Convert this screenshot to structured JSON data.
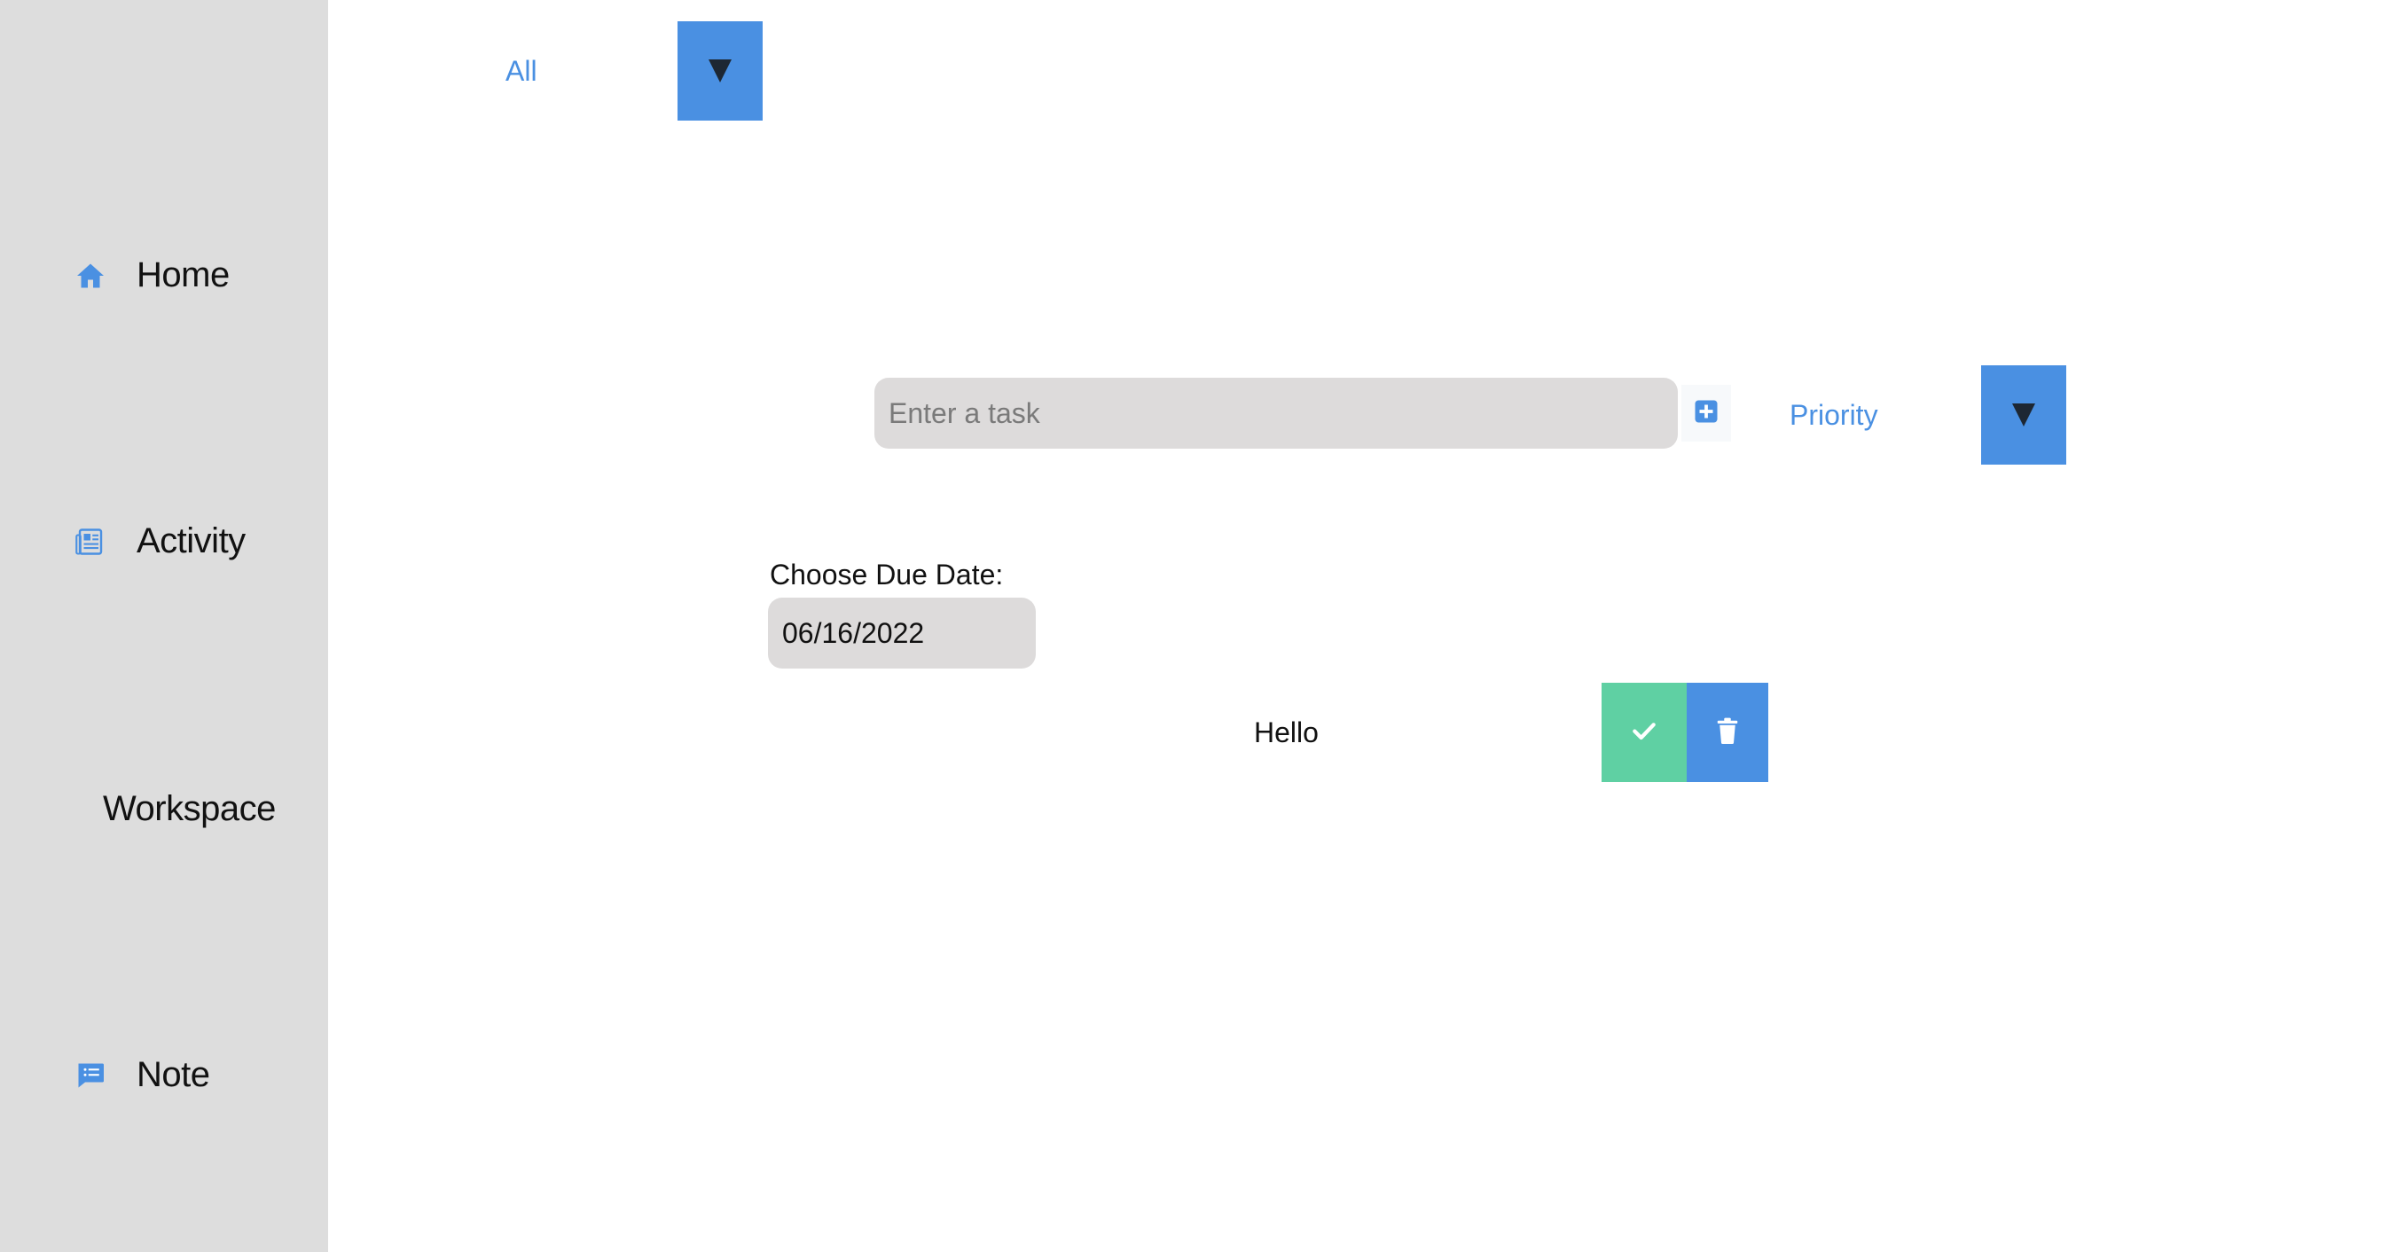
{
  "sidebar": {
    "items": [
      {
        "label": "Home",
        "icon": "home-icon"
      },
      {
        "label": "Activity",
        "icon": "newspaper-icon"
      },
      {
        "label": "Workspace",
        "icon": ""
      },
      {
        "label": "Note",
        "icon": "comment-list-icon"
      }
    ]
  },
  "filter": {
    "selected": "All"
  },
  "task_form": {
    "input_placeholder": "Enter a task",
    "input_value": "",
    "add_icon": "plus-square-icon",
    "priority_selected": "Priority"
  },
  "due_date": {
    "label": "Choose Due Date:",
    "value": "06/16/2022"
  },
  "todos": [
    {
      "text": "Hello",
      "complete_icon": "check-icon",
      "delete_icon": "trash-icon"
    }
  ],
  "colors": {
    "sidebar_bg": "#dddddd",
    "accent_blue": "#4a90e2",
    "complete_green": "#5fd0a3",
    "input_bg": "#dddbdb",
    "arrow_dark": "#1d2733"
  }
}
